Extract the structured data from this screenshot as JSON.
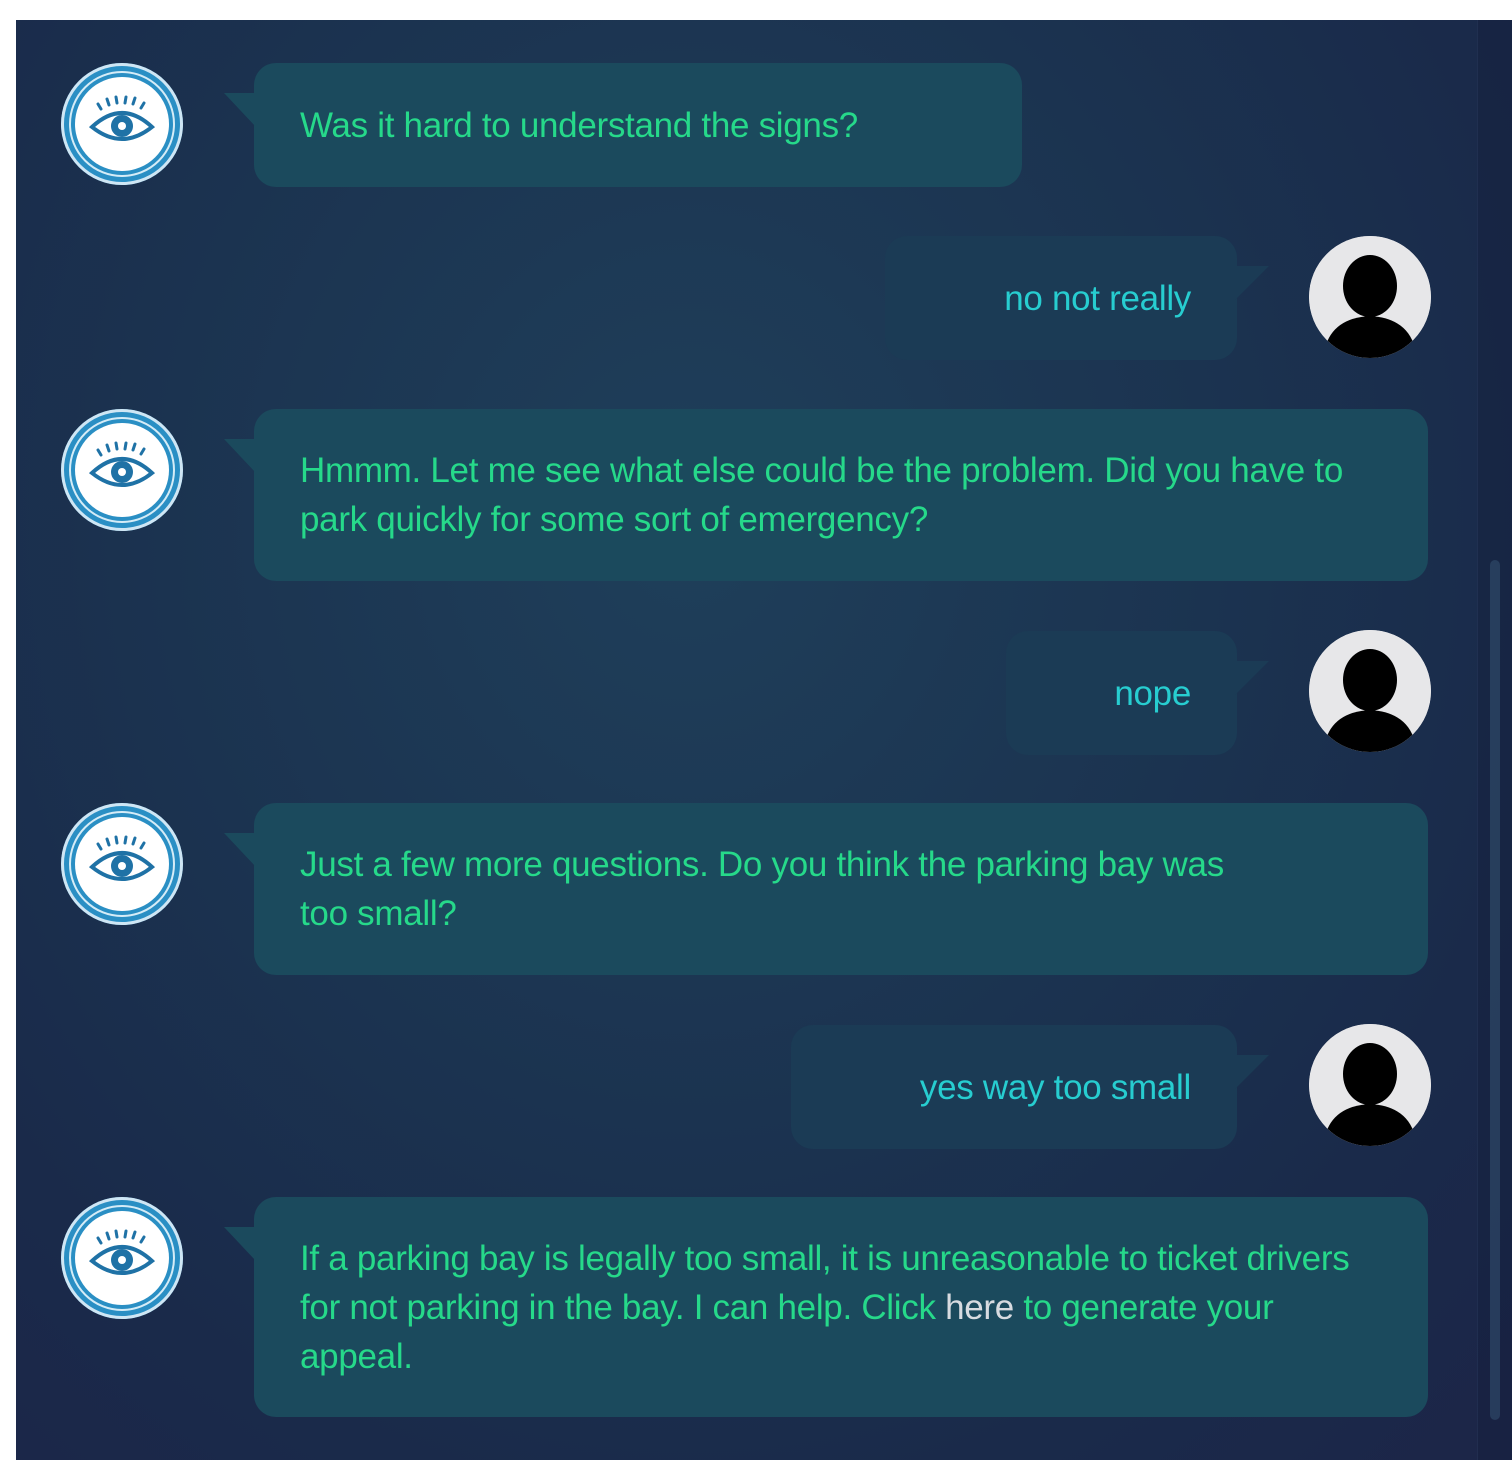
{
  "conversation": {
    "messages": [
      {
        "sender": "bot",
        "text": "Was it hard to understand the signs?"
      },
      {
        "sender": "user",
        "text": "no not really"
      },
      {
        "sender": "bot",
        "text": "Hmmm. Let me see what else could be the problem. Did you have to park quickly for some sort of emergency?"
      },
      {
        "sender": "user",
        "text": "nope"
      },
      {
        "sender": "bot",
        "text": "Just a few more questions. Do you think the parking bay was too small?"
      },
      {
        "sender": "user",
        "text": "yes way too small"
      },
      {
        "sender": "bot",
        "text_before": "If a parking bay is legally too small, it is unreasonable to ticket drivers for not parking in the bay. I can help. Click ",
        "link": "here",
        "text_after": " to generate your appeal."
      }
    ],
    "bot_avatar_icon": "eye-icon",
    "user_avatar_icon": "user-silhouette-icon"
  },
  "colors": {
    "background": "#1b3350",
    "bot_bubble": "#1b4a5d",
    "user_bubble": "#1b3b55",
    "bot_text": "#26d98a",
    "user_text": "#27cdd0",
    "link_text": "#d7dbe0"
  }
}
